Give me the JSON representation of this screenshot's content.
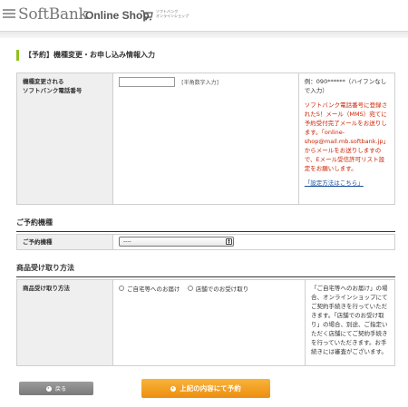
{
  "header": {
    "logo": "SoftBank",
    "shop": "Online Shop",
    "shop_sub_line1": "ソフトバンク",
    "shop_sub_line2": "オンラインショップ"
  },
  "page_title": "【予約】機種変更・お申し込み情報入力",
  "phone_section": {
    "label_line1": "機種変更される",
    "label_line2": "ソフトバンク電話番号",
    "input_value": "",
    "input_hint": "[半角数字入力]",
    "example": "例：090******（ハイフンなしで入力）",
    "warning": "ソフトバンク電話番号に登録されたS！メール（MMS）宛てに予約受付完了メールをお送りします。「online-shop@mail.mb.softbank.jp」からメールをお送りしますので、Eメール受信許可リスト設定をお願いします。",
    "link_text": "「設定方法はこちら」"
  },
  "model_section": {
    "title": "ご予約機種",
    "label": "ご予約機種",
    "select_value": "----"
  },
  "receipt_section": {
    "title": "商品受け取り方法",
    "label": "商品受け取り方法",
    "option_home": "ご自宅等へのお届け",
    "option_store": "店舗でのお受け取り",
    "note": "「ご自宅等へのお届け」の場合、オンラインショップにてご契約手続きを行っていただきます。「店舗でのお受け取り」の場合、別途、ご指定いただく店舗にてご契約手続きを行っていただきます。お手続きには審査がございます。"
  },
  "buttons": {
    "back": "戻る",
    "submit": "上記の内容にて予約"
  },
  "colors": {
    "accent_green": "#8dc21f",
    "submit_orange": "#f39c1f",
    "warning_red": "#cc2200",
    "link_blue": "#1a4f9c"
  }
}
